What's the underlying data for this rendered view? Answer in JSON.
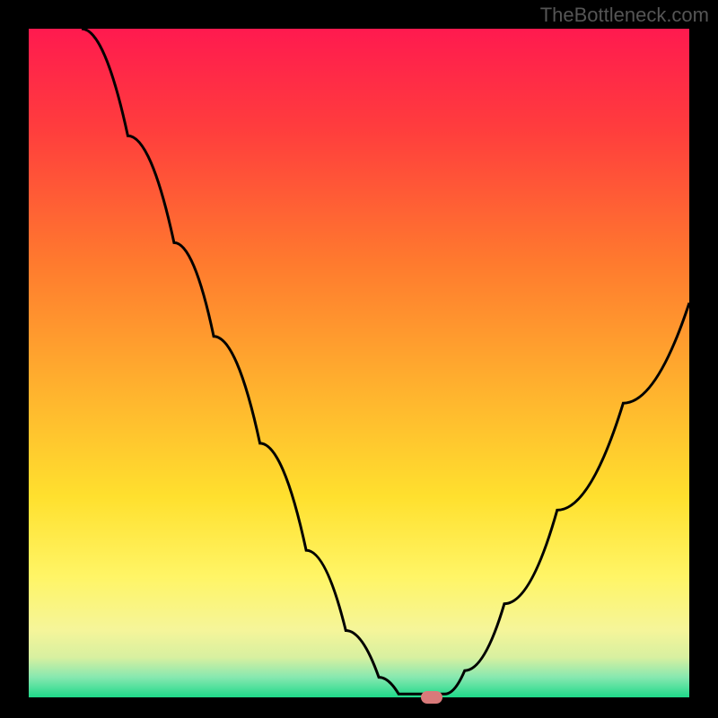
{
  "watermark": "TheBottleneck.com",
  "chart_data": {
    "type": "line",
    "title": "",
    "xlabel": "",
    "ylabel": "",
    "x_range": [
      0,
      100
    ],
    "y_range": [
      0,
      100
    ],
    "curve_points": [
      {
        "x": 8,
        "y": 100
      },
      {
        "x": 15,
        "y": 84
      },
      {
        "x": 22,
        "y": 68
      },
      {
        "x": 28,
        "y": 54
      },
      {
        "x": 35,
        "y": 38
      },
      {
        "x": 42,
        "y": 22
      },
      {
        "x": 48,
        "y": 10
      },
      {
        "x": 53,
        "y": 3
      },
      {
        "x": 56,
        "y": 0.5
      },
      {
        "x": 60,
        "y": 0.5
      },
      {
        "x": 63,
        "y": 0.5
      },
      {
        "x": 66,
        "y": 4
      },
      {
        "x": 72,
        "y": 14
      },
      {
        "x": 80,
        "y": 28
      },
      {
        "x": 90,
        "y": 44
      },
      {
        "x": 100,
        "y": 59
      }
    ],
    "marker": {
      "x": 61,
      "y": 0
    },
    "gradient_stops": [
      {
        "offset": 0,
        "color": "#ff1a4f"
      },
      {
        "offset": 15,
        "color": "#ff3d3d"
      },
      {
        "offset": 35,
        "color": "#ff7a2e"
      },
      {
        "offset": 55,
        "color": "#ffb52e"
      },
      {
        "offset": 70,
        "color": "#ffe02e"
      },
      {
        "offset": 82,
        "color": "#fff566"
      },
      {
        "offset": 90,
        "color": "#f5f59a"
      },
      {
        "offset": 94,
        "color": "#d8f0a0"
      },
      {
        "offset": 97,
        "color": "#87e8b0"
      },
      {
        "offset": 100,
        "color": "#1fd98a"
      }
    ]
  }
}
